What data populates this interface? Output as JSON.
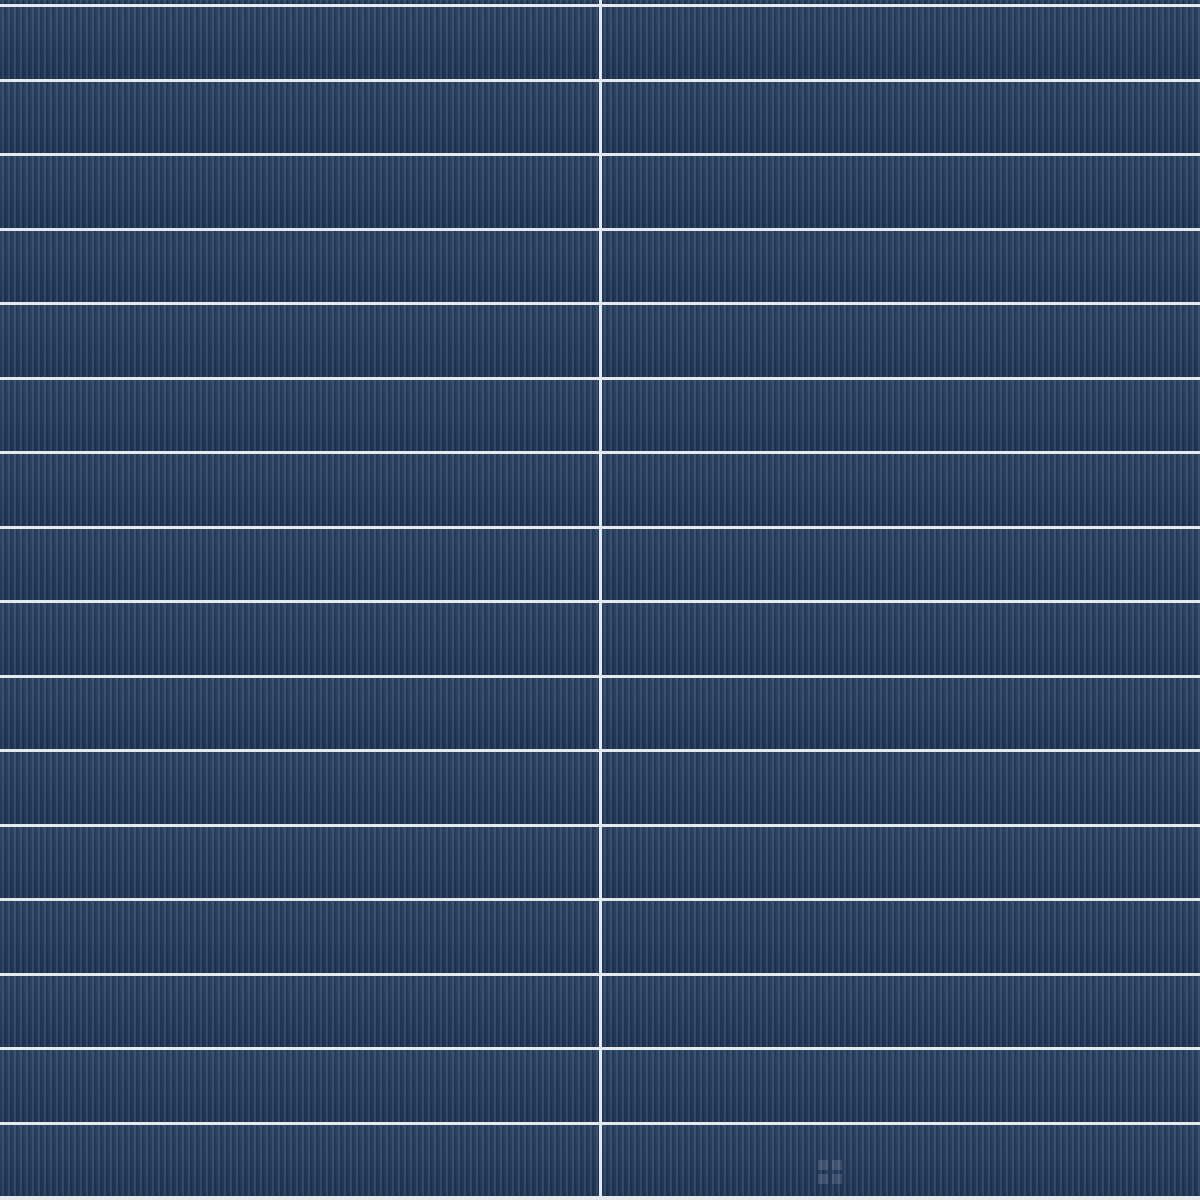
{
  "scene": {
    "subject": "fluted-tile-wall",
    "tile_color": "#233a5b",
    "grout_color": "#e6e9ec",
    "columns": 2,
    "rows": 16
  }
}
